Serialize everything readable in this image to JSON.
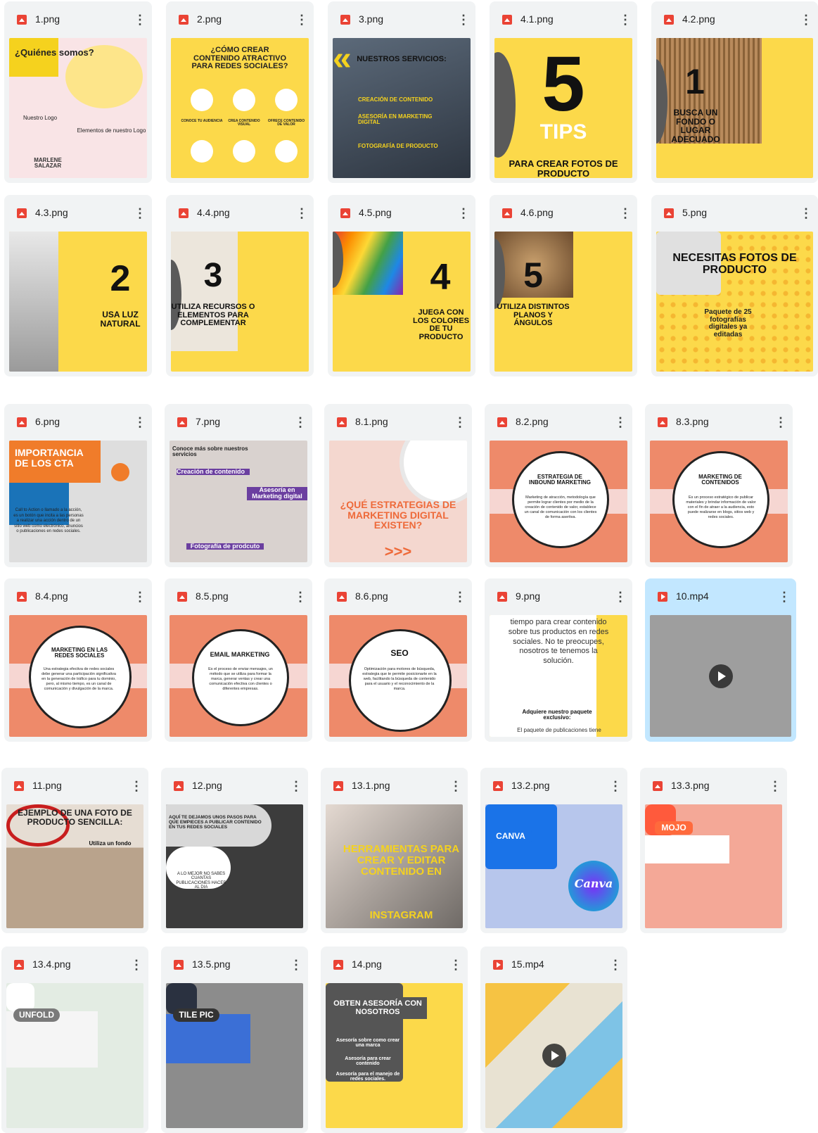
{
  "files": [
    {
      "name": "1.png",
      "type": "image",
      "text": {
        "a": "¿Quiénes somos?",
        "b": "Nuestro Logo",
        "c": "Elementos de nuestro Logo",
        "d": "MARLENE SALAZAR"
      }
    },
    {
      "name": "2.png",
      "type": "image",
      "text": {
        "a": "¿CÓMO CREAR CONTENIDO ATRACTIVO PARA REDES SOCIALES?",
        "b": "CONOCE TU AUDIENCIA",
        "c": "CREA CONTENIDO VISUAL",
        "d": "OFRECE CONTENIDO DE VALOR"
      }
    },
    {
      "name": "3.png",
      "type": "image",
      "text": {
        "a": "NUESTROS SERVICIOS:",
        "b": "CREACIÓN DE CONTENIDO",
        "c": "ASESORÍA EN MARKETING DIGITAL",
        "d": "FOTOGRAFÍA DE PRODUCTO"
      }
    },
    {
      "name": "4.1.png",
      "type": "image",
      "text": {
        "a": "5",
        "b": "TIPS",
        "c": "PARA CREAR FOTOS DE PRODUCTO"
      }
    },
    {
      "name": "4.2.png",
      "type": "image",
      "text": {
        "a": "1",
        "b": "BUSCA UN FONDO O LUGAR ADECUADO"
      }
    },
    {
      "name": "4.3.png",
      "type": "image",
      "text": {
        "a": "2",
        "b": "USA LUZ NATURAL"
      }
    },
    {
      "name": "4.4.png",
      "type": "image",
      "text": {
        "a": "3",
        "b": "UTILIZA RECURSOS O ELEMENTOS PARA COMPLEMENTAR"
      }
    },
    {
      "name": "4.5.png",
      "type": "image",
      "text": {
        "a": "4",
        "b": "JUEGA CON LOS COLORES DE TU PRODUCTO"
      }
    },
    {
      "name": "4.6.png",
      "type": "image",
      "text": {
        "a": "5",
        "b": "UTILIZA DISTINTOS PLANOS Y ÁNGULOS"
      }
    },
    {
      "name": "5.png",
      "type": "image",
      "text": {
        "a": "NECESITAS FOTOS DE PRODUCTO",
        "b": "Paquete de 25 fotografías digitales ya editadas"
      }
    },
    {
      "name": "6.png",
      "type": "image",
      "text": {
        "a": "IMPORTANCIA DE LOS CTA",
        "b": "Call to Action o llamado a la acción, es un botón que incita a las personas a realizar una acción dentro de un sitio web como electrónico, anuncios o publicaciones en redes sociales."
      }
    },
    {
      "name": "7.png",
      "type": "image",
      "text": {
        "a": "Conoce más sobre nuestros servicios",
        "b": "Creación de contenido",
        "c": "Asesoría en Marketing digital",
        "d": "Fotografía de prodcuto"
      }
    },
    {
      "name": "8.1.png",
      "type": "image",
      "text": {
        "a": "¿QUÉ ESTRATEGIAS DE MARKETING DIGITAL EXISTEN?",
        "b": ">>>"
      }
    },
    {
      "name": "8.2.png",
      "type": "image",
      "text": {
        "a": "ESTRATEGIA DE INBOUND MARKETING",
        "b": "Marketing de atracción, metodología que permite lograr clientes por medio de la creación de contenido de valor, establece un canal de comunicación con los clientes de forma asertiva."
      }
    },
    {
      "name": "8.3.png",
      "type": "image",
      "text": {
        "a": "MARKETING DE CONTENIDOS",
        "b": "Es un proceso estratégico de publicar materiales y brindar información de valor con el fin de atraer a la audiencia, esto puede realizarse en blogs, sitios web y redes sociales."
      }
    },
    {
      "name": "8.4.png",
      "type": "image",
      "text": {
        "a": "MARKETING EN LAS REDES SOCIALES",
        "b": "Una estrategia efectiva de redes sociales debe generar una participación significativa en la generación de tráfico para tu dominio, pero, al mismo tiempo, es un canal de comunicación y divulgación de la marca."
      }
    },
    {
      "name": "8.5.png",
      "type": "image",
      "text": {
        "a": "EMAIL MARKETING",
        "b": "Es el proceso de enviar mensajes, un método que se utiliza para formar la marca, generar ventas y crear una comunicación efectiva con clientes o diferentes empresas."
      }
    },
    {
      "name": "8.6.png",
      "type": "image",
      "text": {
        "a": "SEO",
        "b": "Optimización para motores de búsqueda, estrategia que te permite posicionarte en la web, facilitando la búsqueda de contenido para el usuario y el reconocimiento de la marca."
      }
    },
    {
      "name": "9.png",
      "type": "image",
      "text": {
        "a": "tiempo para crear contenido sobre tus productos en redes sociales. No te preocupes, nosotros te tenemos la solución.",
        "b": "Adquiere nuestro paquete exclusivo:",
        "c": "El paquete de publicaciones tiene"
      }
    },
    {
      "name": "10.mp4",
      "type": "video",
      "text": {}
    },
    {
      "name": "11.png",
      "type": "image",
      "text": {
        "a": "EJEMPLO DE UNA FOTO DE PRODUCTO SENCILLA:",
        "b": "Utiliza un fondo"
      }
    },
    {
      "name": "12.png",
      "type": "image",
      "text": {
        "a": "AQUÍ TE DEJAMOS UNOS PASOS PARA QUE EMPIECES A PUBLICAR CONTENIDO EN TUS REDES SOCIALES",
        "b": "A LO MEJOR NO SABES CUANTAS PUBLICACIONES HACER AL DIA"
      }
    },
    {
      "name": "13.1.png",
      "type": "image",
      "text": {
        "a": "HERRAMIENTAS PARA CREAR Y EDITAR CONTENIDO EN",
        "b": "INSTAGRAM"
      }
    },
    {
      "name": "13.2.png",
      "type": "image",
      "text": {
        "a": "CANVA",
        "b": "Canva"
      }
    },
    {
      "name": "13.3.png",
      "type": "image",
      "text": {
        "a": "MOJO"
      }
    },
    {
      "name": "13.4.png",
      "type": "image",
      "text": {
        "a": "UNFOLD"
      }
    },
    {
      "name": "13.5.png",
      "type": "image",
      "text": {
        "a": "TILE PIC"
      }
    },
    {
      "name": "14.png",
      "type": "image",
      "text": {
        "a": "OBTEN ASESORÍA CON NOSOTROS",
        "b": "Asesoría sobre como crear una marca",
        "c": "Asesoría para crear contenido",
        "d": "Asesoría para el manejo de redes sociales."
      }
    },
    {
      "name": "15.mp4",
      "type": "video",
      "text": {}
    }
  ],
  "colors": {
    "card": "#f1f3f4",
    "selected": "#c2e7ff",
    "yellow": "#fcd94a",
    "salmon": "#ee8a6a",
    "pink": "#f6d6d2"
  }
}
